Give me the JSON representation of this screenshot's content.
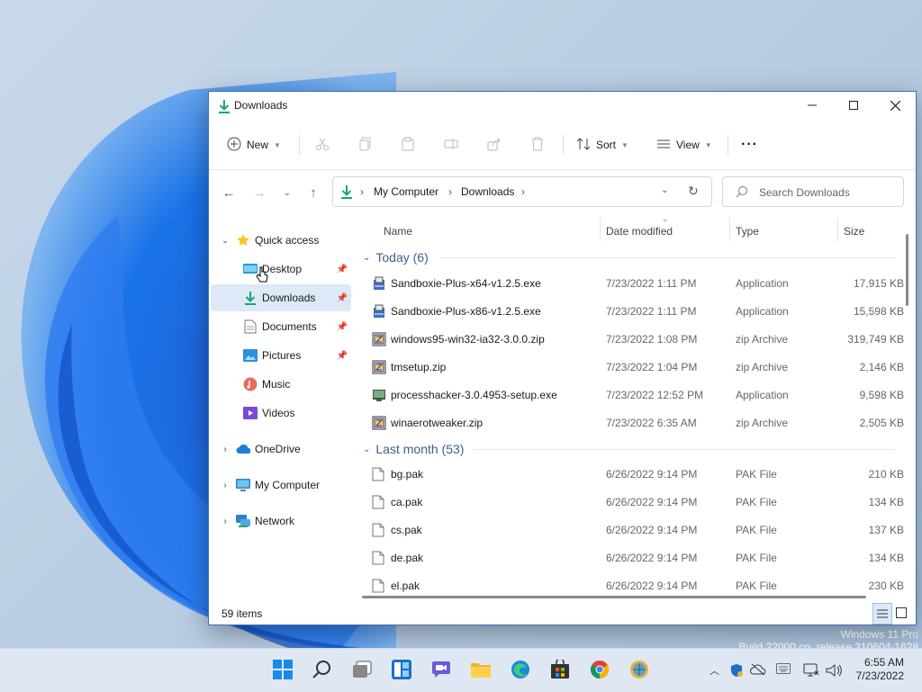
{
  "window": {
    "title": "Downloads"
  },
  "toolbar": {
    "new_label": "New",
    "sort_label": "Sort",
    "view_label": "View",
    "more_label": "···"
  },
  "address": {
    "segments": [
      "My Computer",
      "Downloads"
    ]
  },
  "search": {
    "placeholder": "Search Downloads"
  },
  "sidebar": {
    "quick_access": "Quick access",
    "items": [
      {
        "label": "Desktop"
      },
      {
        "label": "Downloads"
      },
      {
        "label": "Documents"
      },
      {
        "label": "Pictures"
      },
      {
        "label": "Music"
      },
      {
        "label": "Videos"
      }
    ],
    "onedrive": "OneDrive",
    "my_computer": "My Computer",
    "network": "Network"
  },
  "columns": {
    "name": "Name",
    "date": "Date modified",
    "type": "Type",
    "size": "Size"
  },
  "groups": [
    {
      "label": "Today (6)",
      "files": [
        {
          "name": "Sandboxie-Plus-x64-v1.2.5.exe",
          "date": "7/23/2022 1:11 PM",
          "type": "Application",
          "size": "17,915 KB",
          "icon": "installer-icon"
        },
        {
          "name": "Sandboxie-Plus-x86-v1.2.5.exe",
          "date": "7/23/2022 1:11 PM",
          "type": "Application",
          "size": "15,598 KB",
          "icon": "installer-icon"
        },
        {
          "name": "windows95-win32-ia32-3.0.0.zip",
          "date": "7/23/2022 1:08 PM",
          "type": "zip Archive",
          "size": "319,749 KB",
          "icon": "zip-icon"
        },
        {
          "name": "tmsetup.zip",
          "date": "7/23/2022 1:04 PM",
          "type": "zip Archive",
          "size": "2,146 KB",
          "icon": "zip-icon"
        },
        {
          "name": "processhacker-3.0.4953-setup.exe",
          "date": "7/23/2022 12:52 PM",
          "type": "Application",
          "size": "9,598 KB",
          "icon": "setup-icon"
        },
        {
          "name": "winaerotweaker.zip",
          "date": "7/23/2022 6:35 AM",
          "type": "zip Archive",
          "size": "2,505 KB",
          "icon": "zip-icon"
        }
      ]
    },
    {
      "label": "Last month (53)",
      "files": [
        {
          "name": "bg.pak",
          "date": "6/26/2022 9:14 PM",
          "type": "PAK File",
          "size": "210 KB",
          "icon": "file-icon"
        },
        {
          "name": "ca.pak",
          "date": "6/26/2022 9:14 PM",
          "type": "PAK File",
          "size": "134 KB",
          "icon": "file-icon"
        },
        {
          "name": "cs.pak",
          "date": "6/26/2022 9:14 PM",
          "type": "PAK File",
          "size": "137 KB",
          "icon": "file-icon"
        },
        {
          "name": "de.pak",
          "date": "6/26/2022 9:14 PM",
          "type": "PAK File",
          "size": "134 KB",
          "icon": "file-icon"
        },
        {
          "name": "el.pak",
          "date": "6/26/2022 9:14 PM",
          "type": "PAK File",
          "size": "230 KB",
          "icon": "file-icon"
        }
      ]
    }
  ],
  "status": {
    "items": "59 items"
  },
  "watermark": {
    "line1": "Windows 11 Pro",
    "line2": "Build 22000.co_release.210604-1628"
  },
  "clock": {
    "time": "6:55 AM",
    "date": "7/23/2022"
  },
  "colors": {
    "accent": "#0067c0",
    "selection": "#dde9f6",
    "taskbar": "#dfe8f2"
  }
}
